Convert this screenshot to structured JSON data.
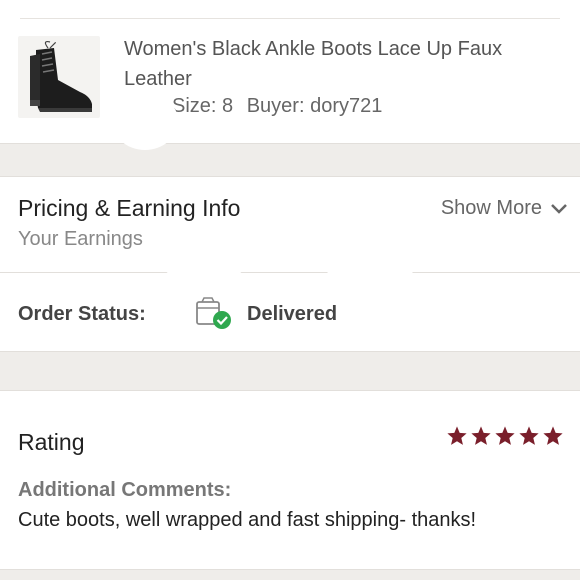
{
  "order_item": {
    "product_title": "Women's Black Ankle Boots Lace Up Faux Leather",
    "size_text": "Size: 8",
    "buyer_text": "Buyer: dory721",
    "thumbnail_icon": "boot-thumbnail"
  },
  "pricing": {
    "title": "Pricing & Earning Info",
    "subtitle": "Your Earnings",
    "show_more_label": "Show More"
  },
  "order_status": {
    "label": "Order Status:",
    "value": "Delivered",
    "icon": "delivered-box-icon",
    "status_color": "#2fa84f"
  },
  "rating": {
    "title": "Rating",
    "stars": 5,
    "star_color": "#7a1f2b",
    "comments_label": "Additional Comments:",
    "comments_text": "Cute boots, well wrapped and fast shipping- thanks!"
  }
}
